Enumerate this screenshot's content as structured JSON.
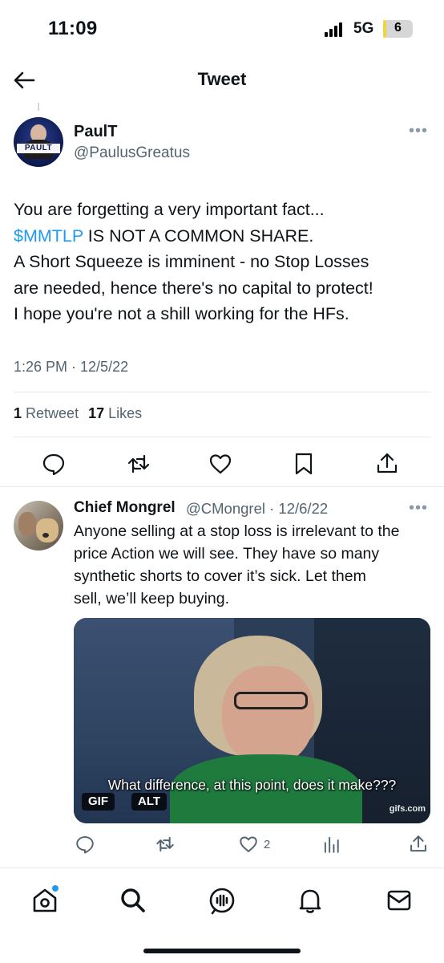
{
  "status_bar": {
    "time": "11:09",
    "network": "5G",
    "battery_level": "6",
    "battery_fraction": 0.06,
    "icons": [
      "signal-icon",
      "battery-icon"
    ]
  },
  "header": {
    "title": "Tweet",
    "back_icon": "arrow-left-icon"
  },
  "main_tweet": {
    "avatar_text": "PAULT",
    "author_name": "PaulT",
    "author_handle": "@PaulusGreatus",
    "more_icon": "more-horizontal-icon",
    "more_glyph": "•••",
    "body": {
      "line1": "You are forgetting a very important fact...",
      "cashtag": "$MMTLP",
      "line2_rest": " IS NOT A COMMON SHARE.",
      "line3": "A Short Squeeze is imminent - no Stop Losses",
      "line4": "are needed, hence there's no capital to protect!",
      "line5": "I hope you're not a shill working for the HFs."
    },
    "timestamp": "1:26 PM · 12/5/22",
    "retweets_count": "1",
    "retweets_label": "Retweet",
    "likes_count": "17",
    "likes_label": "Likes",
    "actions": [
      "reply-icon",
      "retweet-icon",
      "like-icon",
      "bookmark-icon",
      "share-icon"
    ]
  },
  "reply_tweet": {
    "author_name": "Chief Mongrel",
    "author_handle": "@CMongrel",
    "date": "12/6/22",
    "handle_date": "@CMongrel · 12/6/22",
    "more_glyph": "•••",
    "body": {
      "line1": "Anyone selling at a stop loss is irrelevant to the",
      "line2": "price Action we will see. They have so many",
      "line3": "synthetic shorts to cover it’s sick. Let them",
      "line4": "sell, we’ll keep buying."
    },
    "media": {
      "caption": "What difference, at this point, does it make???",
      "badge_gif": "GIF",
      "badge_alt": "ALT",
      "watermark": "gifs.com"
    },
    "like_count": "2",
    "actions": [
      "reply-icon",
      "retweet-icon",
      "like-icon",
      "analytics-icon",
      "share-icon"
    ]
  },
  "tab_bar": {
    "tabs": [
      "home-icon",
      "search-icon",
      "spaces-icon",
      "notifications-icon",
      "messages-icon"
    ],
    "accent_color": "#1d9bf0"
  },
  "colors": {
    "link": "#1d9bf0",
    "text_primary": "#0f1419",
    "text_secondary": "#536471",
    "divider": "#e6e9eb"
  }
}
